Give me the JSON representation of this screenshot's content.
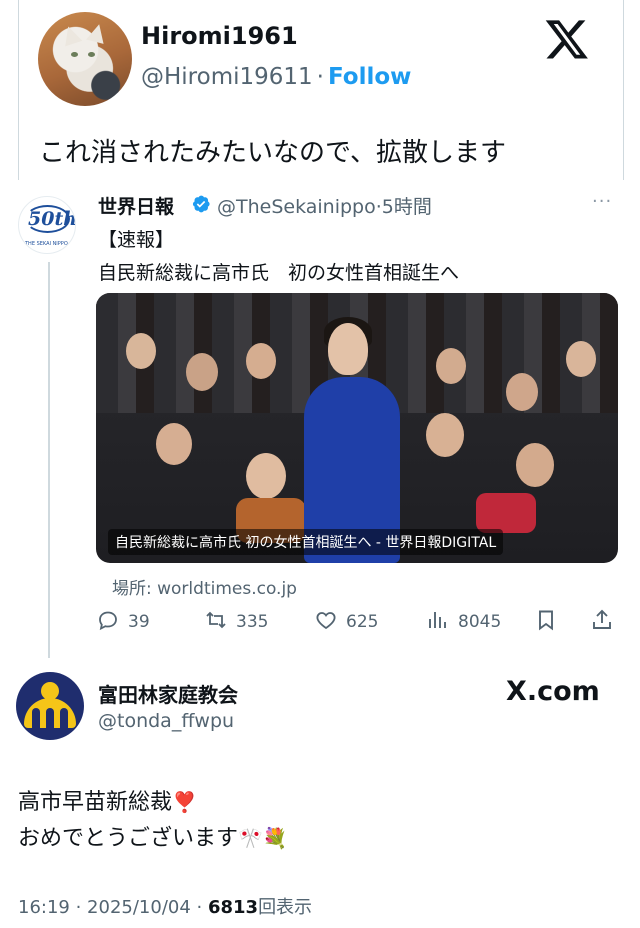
{
  "outer_post": {
    "display_name": "Hiromi1961",
    "handle": "@Hiromi19611",
    "separator": "·",
    "follow_label": "Follow",
    "text": "これ消されたみたいなので、拡散します"
  },
  "quoted_post": {
    "display_name": "世界日報",
    "handle": "@TheSekainippo",
    "time_separator": "·",
    "time": "5時間",
    "more": "···",
    "line1": "【速報】",
    "line2": "自民新総裁に高市氏　初の女性首相誕生へ",
    "avatar_badge": "50th",
    "avatar_caption": "THE SEKAI NIPPO",
    "image_caption": "自民新総裁に高市氏 初の女性首相誕生へ - 世界日報DIGITAL",
    "link_source": "場所: worldtimes.co.jp",
    "stats": {
      "replies": "39",
      "reposts": "335",
      "likes": "625",
      "views": "8045"
    }
  },
  "tonda_post": {
    "display_name": "富田林家庭教会",
    "handle": "@tonda_ffwpu",
    "brand": "X.com",
    "line1": "高市早苗新総裁",
    "line1_emoji": "❣️",
    "line2": "おめでとうございます",
    "line2_emoji_flag": "🎌",
    "line2_emoji_flower": "💐",
    "timestamp": "16:19 · 2025/10/04 · ",
    "views_count": "6813",
    "views_label": "回表示"
  },
  "colors": {
    "accent_blue": "#1d9bf0",
    "text_primary": "#0f1419",
    "text_secondary": "#536471",
    "border": "#cfd9de",
    "suit_blue": "#1f3fa8"
  },
  "icons": [
    "x-logo-icon",
    "verified-badge-icon",
    "reply-icon",
    "repost-icon",
    "like-icon",
    "views-icon",
    "bookmark-icon",
    "share-icon"
  ]
}
